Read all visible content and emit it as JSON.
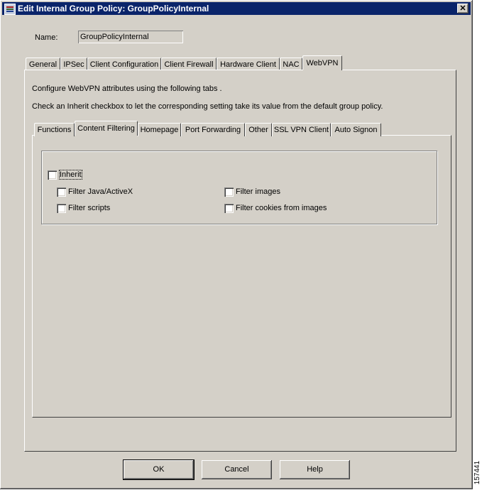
{
  "window": {
    "title": "Edit Internal Group Policy: GroupPolicyInternal",
    "close_label": "✕"
  },
  "name_field": {
    "label": "Name:",
    "value": "GroupPolicyInternal"
  },
  "main_tabs": [
    "General",
    "IPSec",
    "Client Configuration",
    "Client Firewall",
    "Hardware Client",
    "NAC",
    "WebVPN"
  ],
  "main_tabs_selected": "WebVPN",
  "webvpn": {
    "intro": "Configure WebVPN attributes using the following tabs .",
    "inherit_note": "Check an Inherit checkbox to let the corresponding setting take its value from the default group policy.",
    "sub_tabs": [
      "Functions",
      "Content Filtering",
      "Homepage",
      "Port Forwarding",
      "Other",
      "SSL VPN Client",
      "Auto Signon"
    ],
    "sub_tabs_selected": "Content Filtering",
    "content_filtering": {
      "inherit_label": "Inherit",
      "filter_java_label": "Filter Java/ActiveX",
      "filter_images_label": "Filter images",
      "filter_scripts_label": "Filter scripts",
      "filter_cookies_label": "Filter cookies from images"
    }
  },
  "buttons": {
    "ok": "OK",
    "cancel": "Cancel",
    "help": "Help"
  },
  "figure_number": "157441"
}
